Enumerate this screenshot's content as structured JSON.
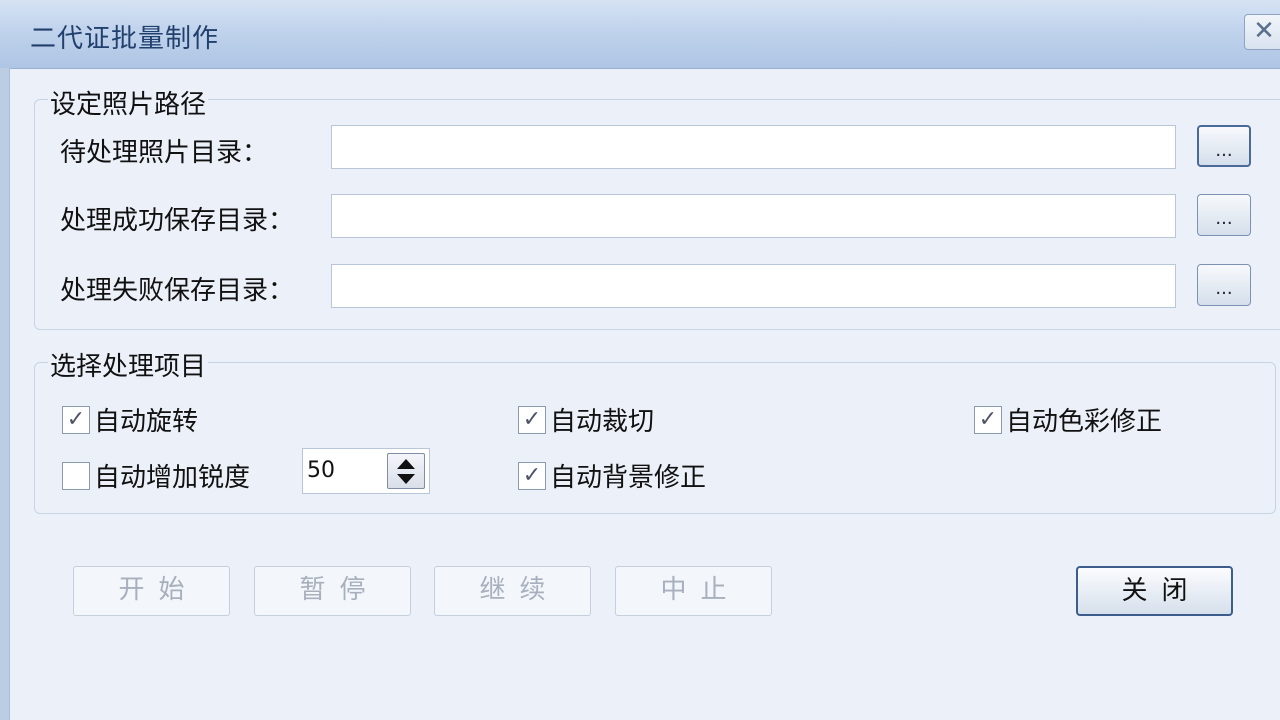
{
  "window": {
    "title": "二代证批量制作",
    "close_label": "✕"
  },
  "paths": {
    "group_title": "设定照片路径",
    "rows": [
      {
        "label": "待处理照片目录：",
        "value": "",
        "browse_label": "..."
      },
      {
        "label": "处理成功保存目录：",
        "value": "",
        "browse_label": "..."
      },
      {
        "label": "处理失败保存目录：",
        "value": "",
        "browse_label": "..."
      }
    ]
  },
  "options": {
    "group_title": "选择处理项目",
    "checkboxes": [
      {
        "label": "自动旋转",
        "checked": true
      },
      {
        "label": "自动裁切",
        "checked": true
      },
      {
        "label": "自动色彩修正",
        "checked": true
      },
      {
        "label": "自动增加锐度",
        "checked": false
      },
      {
        "label": "自动背景修正",
        "checked": true
      }
    ],
    "sharpness_value": "50"
  },
  "buttons": {
    "start": "开始",
    "pause": "暂停",
    "resume": "继续",
    "stop": "中止",
    "close": "关闭"
  }
}
